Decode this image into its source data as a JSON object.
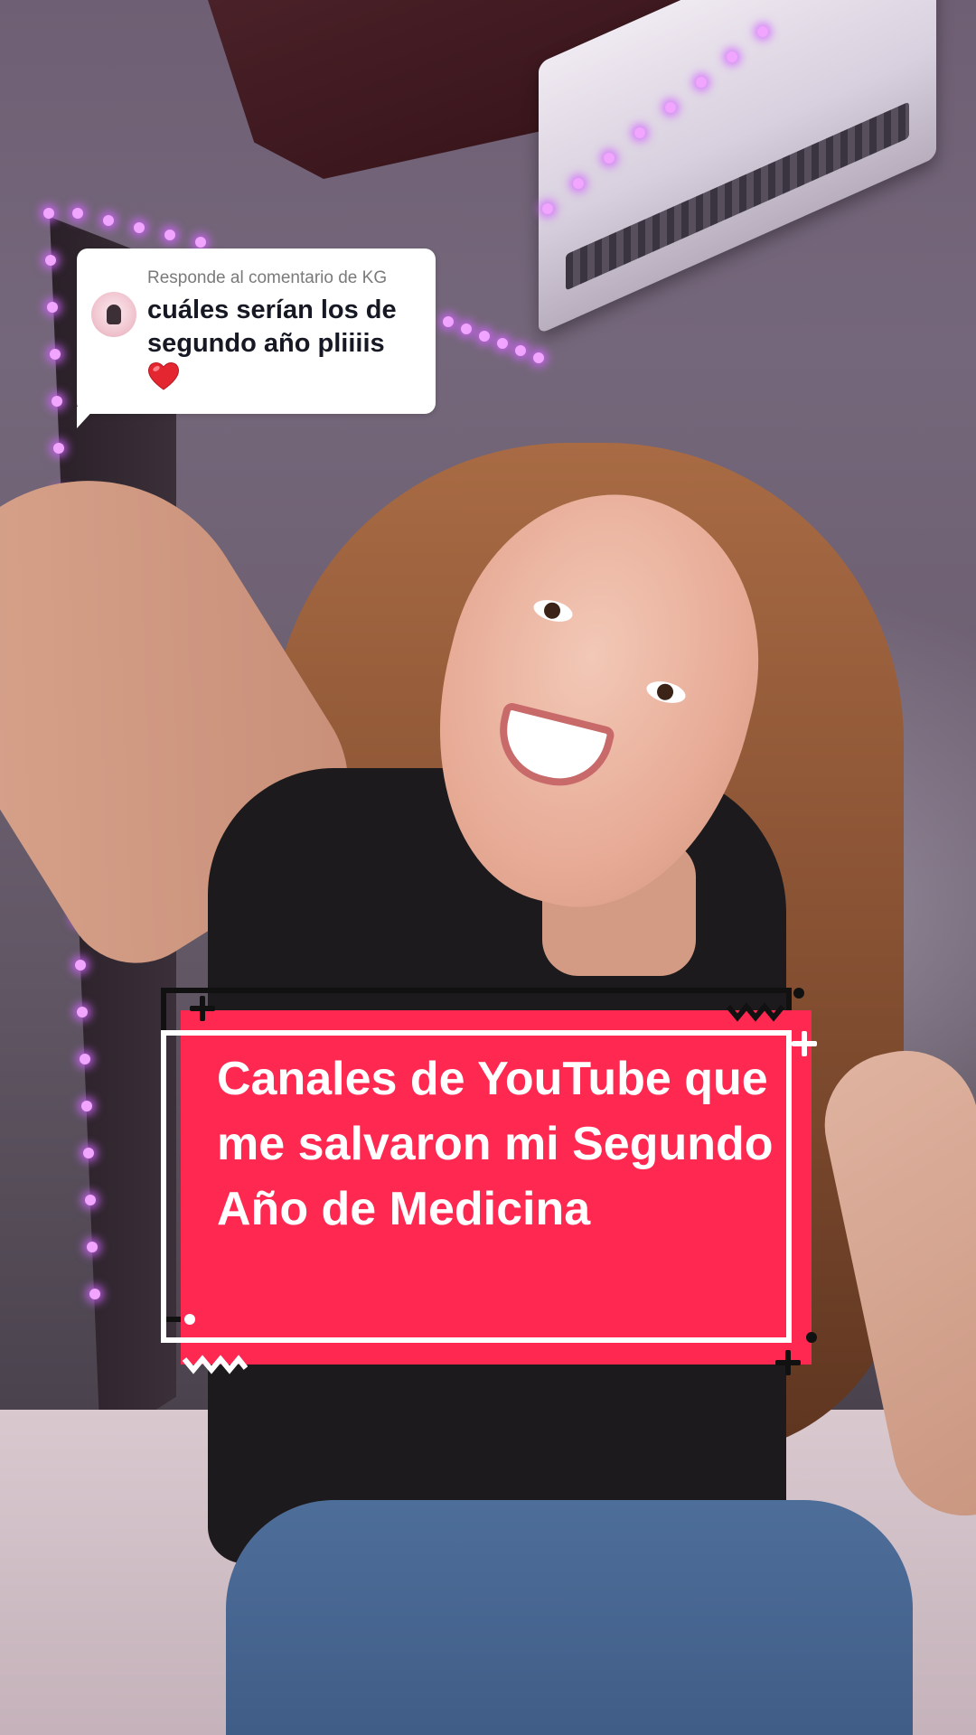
{
  "reply_comment": {
    "header": "Responde al comentario de KG",
    "text": "cuáles serían los de segundo año pliiiis",
    "emoji_icon": "red-heart-icon"
  },
  "title_card": {
    "title": "Canales de YouTube que me salvaron mi Segundo Año de Medicina",
    "colors": {
      "card_fill": "#fe2851",
      "text": "#ffffff",
      "frame_dark": "#111111",
      "frame_light": "#ffffff"
    }
  }
}
